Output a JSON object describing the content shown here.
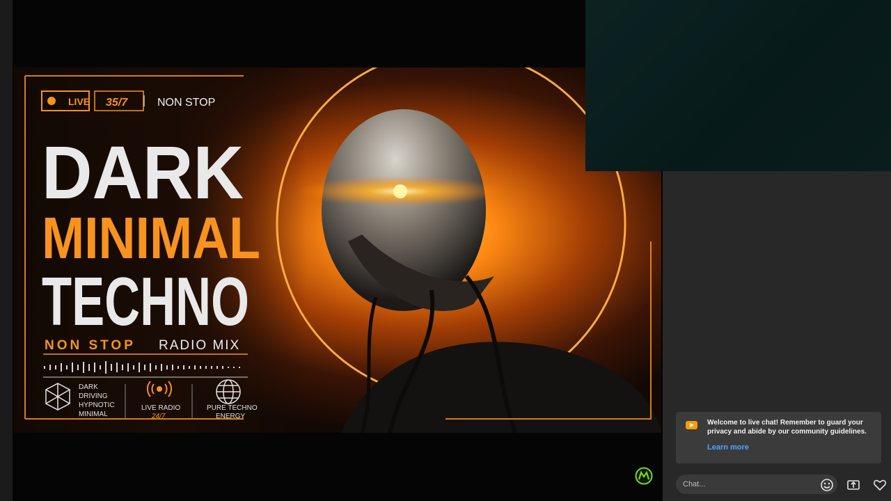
{
  "thumbnail": {
    "live_badge": "LIVE",
    "hours_badge": "35/7",
    "header_tag": "NON STOP",
    "title_line1": "DARK",
    "title_line2": "MINIMAL",
    "title_line3": "TECHNO",
    "subtitle_accent": "NON STOP",
    "subtitle_rest": "RADIO MIX",
    "features": [
      {
        "icon": "geometric-sphere-icon",
        "lines": [
          "DARK",
          "DRIVING",
          "HYPNOTIC",
          "MINIMAL"
        ]
      },
      {
        "icon": "broadcast-icon",
        "label": "LIVE RADIO",
        "sub": "24/7"
      },
      {
        "icon": "globe-icon",
        "label": "PURE TECHNO",
        "sub": "ENERGY"
      }
    ],
    "colors": {
      "accent": "#f7931e",
      "title": "#e9e9e9"
    }
  },
  "chat": {
    "notice_text": "Welcome to live chat! Remember to guard your privacy and abide by our community guidelines.",
    "learn_more": "Learn more",
    "input_placeholder": "Chat...",
    "buttons": [
      "emoji-icon",
      "super-chat-icon",
      "heart-icon"
    ]
  }
}
